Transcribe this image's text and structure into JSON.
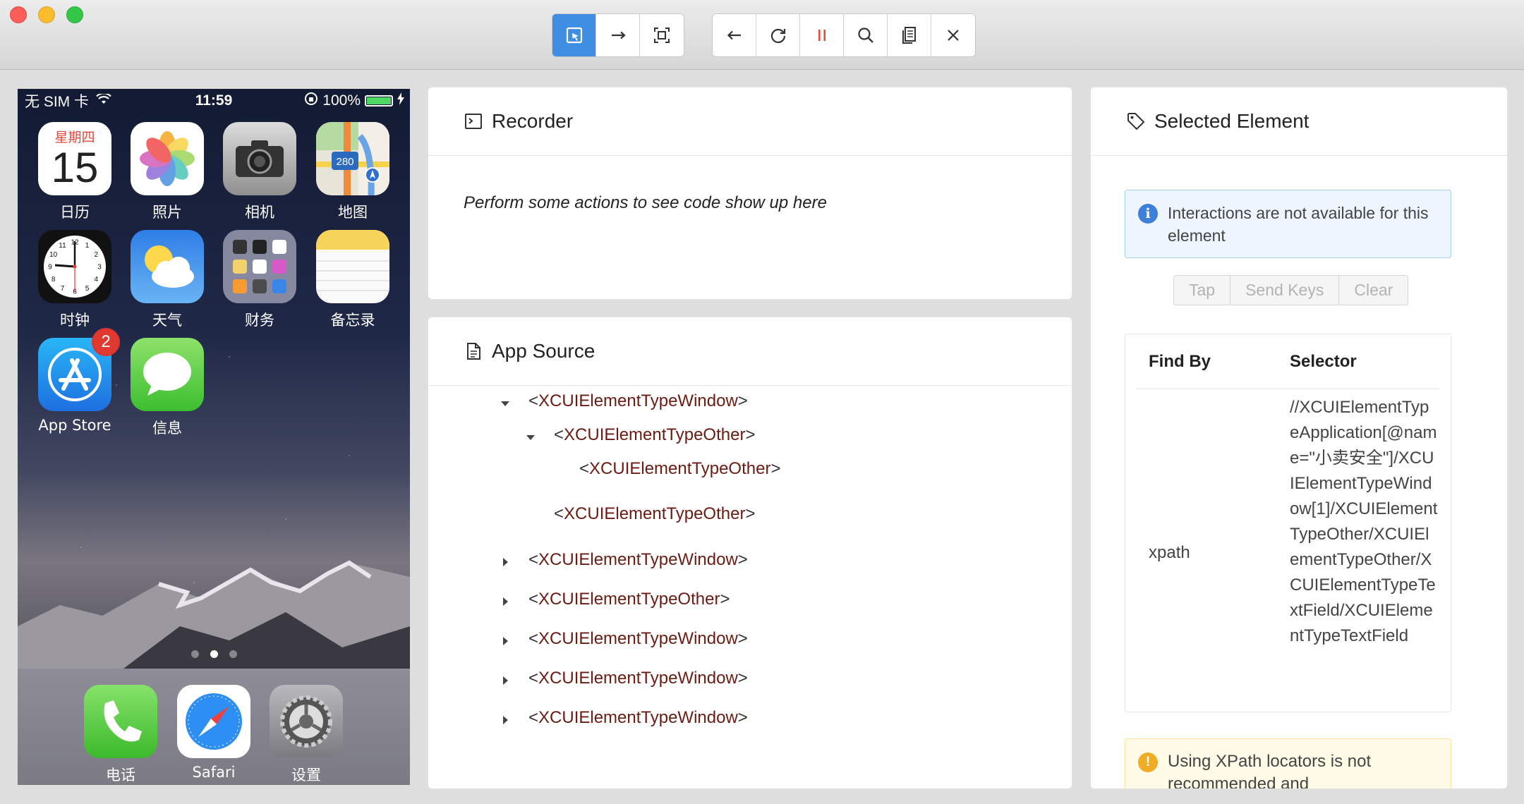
{
  "toolbar": {
    "group1": [
      "select-elements-icon",
      "swipe-icon",
      "screenshot-icon"
    ],
    "group2": [
      "back-icon",
      "refresh-icon",
      "pause-icon",
      "search-icon",
      "copy-xml-icon",
      "close-icon"
    ]
  },
  "device": {
    "status": {
      "carrier": "无 SIM 卡",
      "time": "11:59",
      "battery": "100%"
    },
    "calendar": {
      "weekday": "星期四",
      "day": "15"
    },
    "maps_badge": "280",
    "apps": [
      {
        "label": "日历"
      },
      {
        "label": "照片"
      },
      {
        "label": "相机"
      },
      {
        "label": "地图"
      },
      {
        "label": "时钟"
      },
      {
        "label": "天气"
      },
      {
        "label": "财务"
      },
      {
        "label": "备忘录"
      },
      {
        "label": "App Store",
        "badge": "2"
      },
      {
        "label": "信息"
      }
    ],
    "clock": {
      "numbers": [
        "12",
        "1",
        "2",
        "3",
        "4",
        "5",
        "6",
        "7",
        "8",
        "9",
        "10",
        "11"
      ]
    },
    "dock": [
      {
        "label": "电话"
      },
      {
        "label": "Safari"
      },
      {
        "label": "设置"
      }
    ]
  },
  "recorder": {
    "title": "Recorder",
    "message": "Perform some actions to see code show up here"
  },
  "app_source": {
    "title": "App Source",
    "nodes": [
      {
        "lt": "<",
        "name": "XCUIElementTypeWindow",
        "gt": ">",
        "caret": "expanded"
      },
      {
        "lt": "<",
        "name": "XCUIElementTypeOther",
        "gt": ">",
        "caret": "expanded"
      },
      {
        "lt": "<",
        "name": "XCUIElementTypeOther",
        "gt": ">",
        "caret": "none"
      },
      {
        "lt": "<",
        "name": "XCUIElementTypeOther",
        "gt": ">",
        "caret": "none"
      },
      {
        "lt": "<",
        "name": "XCUIElementTypeWindow",
        "gt": ">",
        "caret": "collapsed"
      },
      {
        "lt": "<",
        "name": "XCUIElementTypeOther",
        "gt": ">",
        "caret": "collapsed"
      },
      {
        "lt": "<",
        "name": "XCUIElementTypeWindow",
        "gt": ">",
        "caret": "collapsed"
      },
      {
        "lt": "<",
        "name": "XCUIElementTypeWindow",
        "gt": ">",
        "caret": "collapsed"
      },
      {
        "lt": "<",
        "name": "XCUIElementTypeWindow",
        "gt": ">",
        "caret": "collapsed"
      }
    ]
  },
  "selected": {
    "title": "Selected Element",
    "info": "Interactions are not available for this element",
    "actions": {
      "tap": "Tap",
      "send_keys": "Send Keys",
      "clear": "Clear"
    },
    "table": {
      "col_find": "Find By",
      "col_selector": "Selector",
      "find_by": "xpath",
      "selector": "//XCUIElementTypeApplication[@name=\"小卖安全\"]/XCUIElementTypeWindow[1]/XCUIElementTypeOther/XCUIElementTypeOther/XCUIElementTypeTextField/XCUIElementTypeTextField"
    },
    "warning": "Using XPath locators is not recommended and"
  }
}
